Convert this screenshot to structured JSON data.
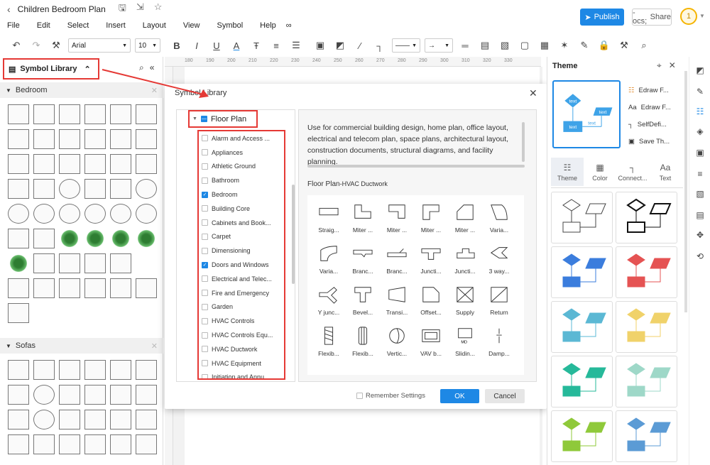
{
  "app": {
    "title": "Children Bedroom Plan",
    "publish_label": "Publish",
    "share_label": "Share",
    "avatar_text": "1"
  },
  "menu": [
    "File",
    "Edit",
    "Select",
    "Insert",
    "Layout",
    "View",
    "Symbol",
    "Help"
  ],
  "toolbar": {
    "font_family": "Arial",
    "font_size": "10"
  },
  "left_panel": {
    "title": "Symbol Library",
    "sections": [
      {
        "label": "Bedroom"
      },
      {
        "label": "Sofas"
      }
    ]
  },
  "dialog": {
    "title": "Symbol Library",
    "root_category": "Floor Plan",
    "categories": [
      {
        "label": "Alarm and Access ...",
        "checked": false
      },
      {
        "label": "Appliances",
        "checked": false
      },
      {
        "label": "Athletic Ground",
        "checked": false
      },
      {
        "label": "Bathroom",
        "checked": false
      },
      {
        "label": "Bedroom",
        "checked": true
      },
      {
        "label": "Building Core",
        "checked": false
      },
      {
        "label": "Cabinets and Book...",
        "checked": false
      },
      {
        "label": "Carpet",
        "checked": false
      },
      {
        "label": "Dimensioning",
        "checked": false
      },
      {
        "label": "Doors and Windows",
        "checked": true
      },
      {
        "label": "Electrical and Telec...",
        "checked": false
      },
      {
        "label": "Fire and Emergency",
        "checked": false
      },
      {
        "label": "Garden",
        "checked": false
      },
      {
        "label": "HVAC Controls",
        "checked": false
      },
      {
        "label": "HVAC Controls Equ...",
        "checked": false
      },
      {
        "label": "HVAC Ductwork",
        "checked": false
      },
      {
        "label": "HVAC Equipment",
        "checked": false
      },
      {
        "label": "Initiation and Annu...",
        "checked": false
      }
    ],
    "description": "Use for commercial building design, home plan, office layout, electrical and telecom plan, space plans, architectural layout, construction documents, structural diagrams, and facility planning.",
    "subtitle_main": "Floor Plan",
    "subtitle_sub": "-HVAC Ductwork",
    "shapes": [
      "Straig...",
      "Miter ...",
      "Miter ...",
      "Miter ...",
      "Miter ...",
      "Varia...",
      "Varia...",
      "Branc...",
      "Branc...",
      "Juncti...",
      "Juncti...",
      "3 way...",
      "Y junc...",
      "Bevel...",
      "Transi...",
      "Offset...",
      "Supply",
      "Return",
      "Flexib...",
      "Flexib...",
      "Vertic...",
      "VAV b...",
      "Slidin...",
      "Damp..."
    ],
    "remember_label": "Remember Settings",
    "ok_label": "OK",
    "cancel_label": "Cancel"
  },
  "right_panel": {
    "title": "Theme",
    "theme_options": [
      "Edraw F...",
      "Edraw F...",
      "SelfDefi...",
      "Save Th..."
    ],
    "tabs": [
      "Theme",
      "Color",
      "Connect...",
      "Text"
    ],
    "preview_texts": [
      "text",
      "text",
      "text",
      "text"
    ],
    "theme_colors": [
      "#444444",
      "#111111",
      "#3b7ddd",
      "#e55353",
      "#5bb8d4",
      "#f0d26a",
      "#26b99a",
      "#9ed8c8",
      "#8fc93a",
      "#5b9bd5"
    ]
  },
  "ruler_ticks": [
    "180",
    "190",
    "200",
    "210",
    "220",
    "230",
    "240",
    "250",
    "260",
    "270",
    "280",
    "290",
    "300",
    "310",
    "320",
    "330"
  ]
}
